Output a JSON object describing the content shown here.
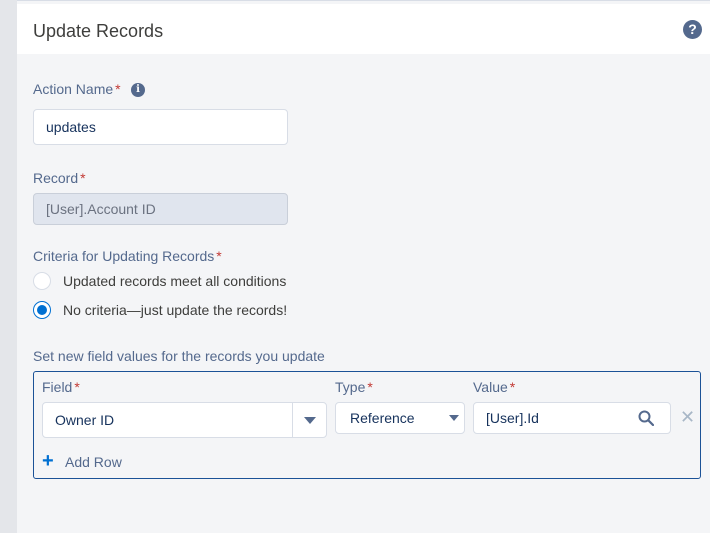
{
  "panel": {
    "title": "Update Records",
    "help_icon": "question-circle-icon"
  },
  "form": {
    "required_marker": "*",
    "action_name": {
      "label": "Action Name",
      "info_icon": "info-icon",
      "value": "updates"
    },
    "record": {
      "label": "Record",
      "value": "[User].Account ID"
    },
    "criteria": {
      "label": "Criteria for Updating Records",
      "options": [
        {
          "label": "Updated records meet all conditions",
          "selected": false
        },
        {
          "label": "No criteria—just update the records!",
          "selected": true
        }
      ]
    },
    "field_values": {
      "heading": "Set new field values for the records you update",
      "columns": {
        "field": "Field",
        "type": "Type",
        "value": "Value"
      },
      "rows": [
        {
          "field": "Owner ID",
          "type": "Reference",
          "value": "[User].Id"
        }
      ],
      "add_row_label": "Add Row"
    }
  },
  "colors": {
    "accent": "#0070d2",
    "required": "#c23934",
    "label": "#54698d",
    "border_active": "#1b5297"
  }
}
